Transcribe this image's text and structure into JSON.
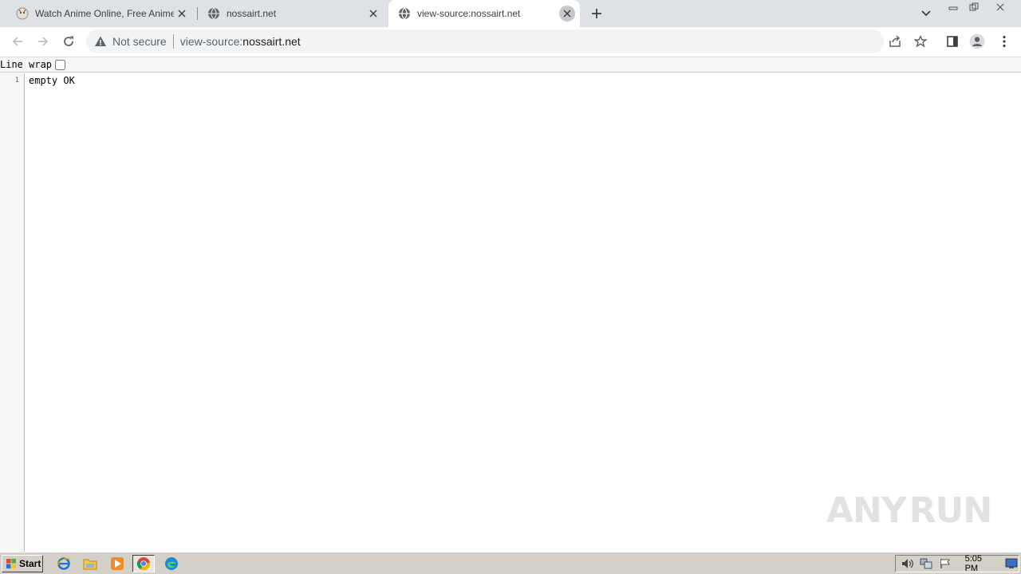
{
  "browser": {
    "tabs": [
      {
        "title": "Watch Anime Online, Free Anime Str",
        "favicon": "anime-site-icon",
        "active": false
      },
      {
        "title": "nossairt.net",
        "favicon": "globe-icon",
        "active": false
      },
      {
        "title": "view-source:nossairt.net",
        "favicon": "globe-icon",
        "active": true
      }
    ],
    "omnibox": {
      "security_label": "Not secure",
      "url_scheme": "view-source:",
      "url_host": "nossairt.net"
    }
  },
  "page": {
    "line_wrap_label": "Line wrap",
    "line_wrap_checked": false,
    "lines": [
      {
        "number": "1",
        "text": "empty OK"
      }
    ]
  },
  "watermark": {
    "left": "ANY",
    "right": "RUN"
  },
  "taskbar": {
    "start_label": "Start",
    "apps": [
      "ie-icon",
      "explorer-folder-icon",
      "media-player-icon",
      "chrome-icon",
      "edge-icon"
    ],
    "clock": "5:05 PM"
  },
  "colors": {
    "tabstrip_bg": "#dee1e6",
    "omnibox_bg": "#f1f3f4",
    "taskbar_bg": "#d4d0c8"
  }
}
